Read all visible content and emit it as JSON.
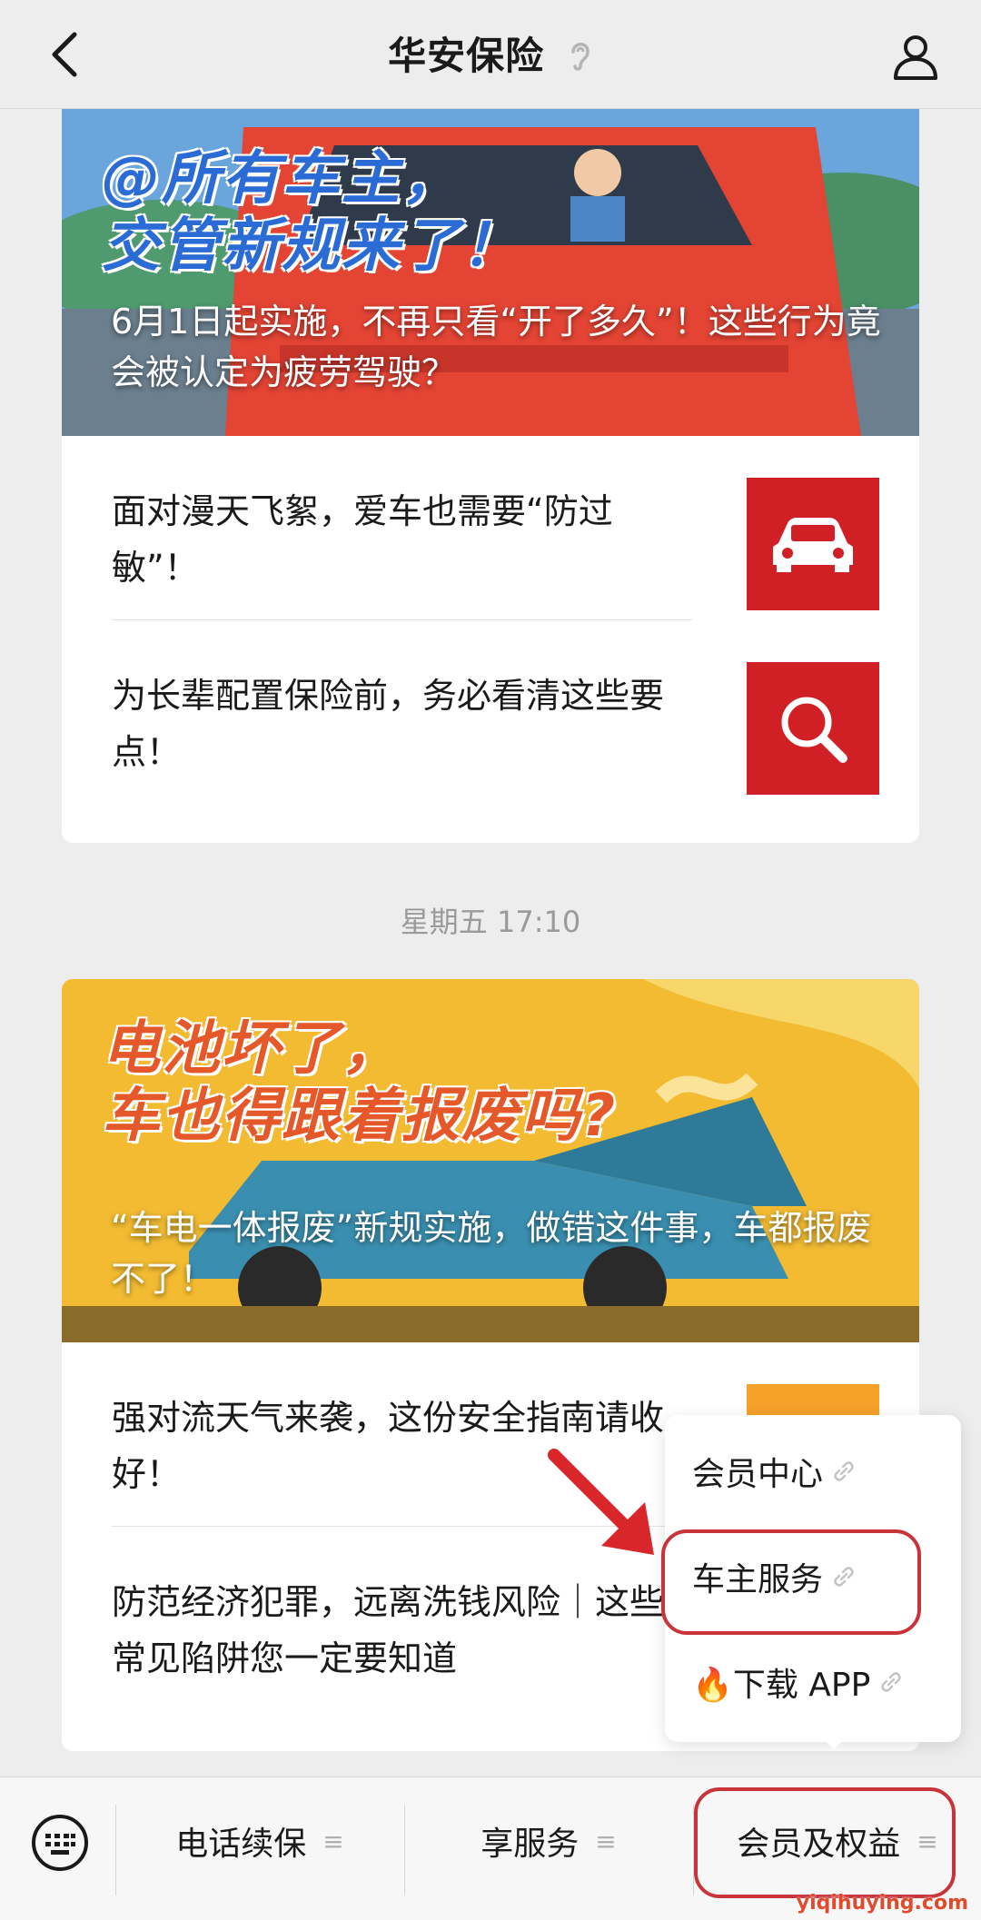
{
  "header": {
    "title": "华安保险"
  },
  "card1": {
    "hero_headline_line1": "@所有车主，",
    "hero_headline_line2": "交管新规来了！",
    "hero_caption": "6月1日起实施，不再只看“开了多久”！这些行为竟会被认定为疲劳驾驶？",
    "items": [
      {
        "text": "面对漫天飞絮，爱车也需要“防过敏”！",
        "thumb_icon": "car-icon"
      },
      {
        "text": "为长辈配置保险前，务必看清这些要点！",
        "thumb_icon": "magnifier-icon"
      }
    ]
  },
  "timestamp": "星期五 17:10",
  "card2": {
    "hero_headline_line1": "电池坏了，",
    "hero_headline_line2": "车也得跟着报废吗?",
    "hero_caption": "“车电一体报废”新规实施，做错这件事，车都报废不了！",
    "items": [
      {
        "text": "强对流天气来袭，这份安全指南请收好！"
      },
      {
        "text": "防范经济犯罪，远离洗钱风险｜这些常见陷阱您一定要知道"
      }
    ]
  },
  "popup_menu": {
    "items": [
      {
        "label": "会员中心"
      },
      {
        "label": "车主服务"
      },
      {
        "label": "🔥下载 APP"
      }
    ]
  },
  "bottom_bar": {
    "tabs": [
      {
        "label": "电话续保"
      },
      {
        "label": "享服务"
      },
      {
        "label": "会员及权益"
      }
    ]
  },
  "watermark": "yiqihuying.com",
  "colors": {
    "accent_red": "#d11f26",
    "highlight": "#c9343b",
    "orange_thumb": "#f5a12a"
  }
}
